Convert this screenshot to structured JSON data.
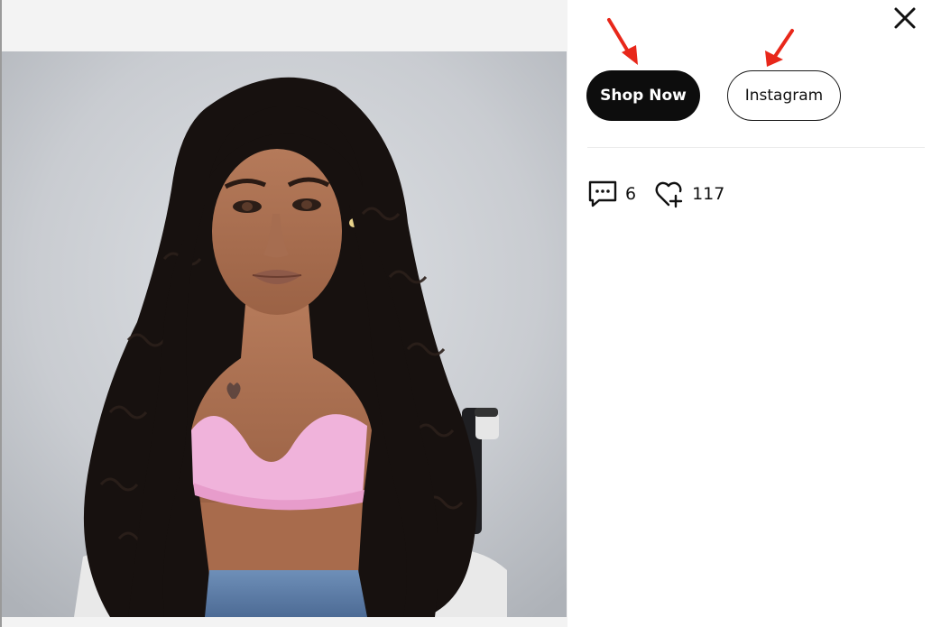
{
  "actions": {
    "shop_now_label": "Shop Now",
    "instagram_label": "Instagram"
  },
  "stats": {
    "comments_count": "6",
    "likes_count": "117"
  },
  "icons": {
    "close": "close-icon",
    "comments": "comment-icon",
    "likes": "heart-plus-icon",
    "annotations": "red-arrow"
  },
  "colors": {
    "primary_button_bg": "#0d0d0d",
    "primary_button_text": "#ffffff",
    "secondary_button_border": "#1a1a1a",
    "annotation_arrow": "#e8271a",
    "media_pane_bg": "#f3f3f3"
  }
}
